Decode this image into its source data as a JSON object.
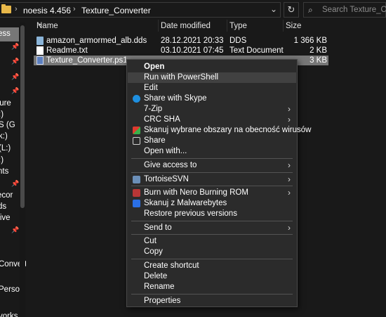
{
  "breadcrumb": {
    "items": [
      "noesis 4.456",
      "Texture_Converter"
    ]
  },
  "search": {
    "placeholder": "Search Texture_Converter"
  },
  "icons": {
    "folder": "folder-icon",
    "refresh": "refresh-icon",
    "search": "search-icon",
    "chevron": "chevron-down-icon",
    "pin": "pin-icon"
  },
  "nav": {
    "items": [
      "ess",
      "ture",
      ":)",
      "S (G",
      "k:)",
      "(L:)",
      ":)",
      "nts",
      "ecor",
      "ds",
      "rive",
      "Convert",
      "Person",
      "vorks"
    ]
  },
  "columns": {
    "name": "Name",
    "date": "Date modified",
    "type": "Type",
    "size": "Size"
  },
  "files": [
    {
      "name": "amazon_armormed_alb.dds",
      "date": "28.12.2021 20:33",
      "type": "DDS",
      "size": "1 366 KB"
    },
    {
      "name": "Readme.txt",
      "date": "03.10.2021 07:45",
      "type": "Text Document",
      "size": "2 KB"
    },
    {
      "name": "Texture_Converter.ps1",
      "date": "",
      "type": "",
      "size": "3 KB"
    }
  ],
  "menu": {
    "open": "Open",
    "run_powershell": "Run with PowerShell",
    "edit": "Edit",
    "share_skype": "Share with Skype",
    "zip": "7-Zip",
    "crc": "CRC SHA",
    "scan": "Skanuj wybrane obszary na obecność wirusów",
    "share": "Share",
    "open_with": "Open with...",
    "give_access": "Give access to",
    "tortoise": "TortoiseSVN",
    "nero": "Burn with Nero Burning ROM",
    "malwarebytes": "Skanuj z Malwarebytes",
    "restore": "Restore previous versions",
    "send_to": "Send to",
    "cut": "Cut",
    "copy": "Copy",
    "create_shortcut": "Create shortcut",
    "delete": "Delete",
    "rename": "Rename",
    "properties": "Properties"
  },
  "colors": {
    "background": "#191919",
    "selected_row": "#777777",
    "menu_bg": "#2b2b2b",
    "menu_hover": "#414141",
    "skype": "#1e8fe0",
    "malwarebytes": "#2a6fe6"
  }
}
